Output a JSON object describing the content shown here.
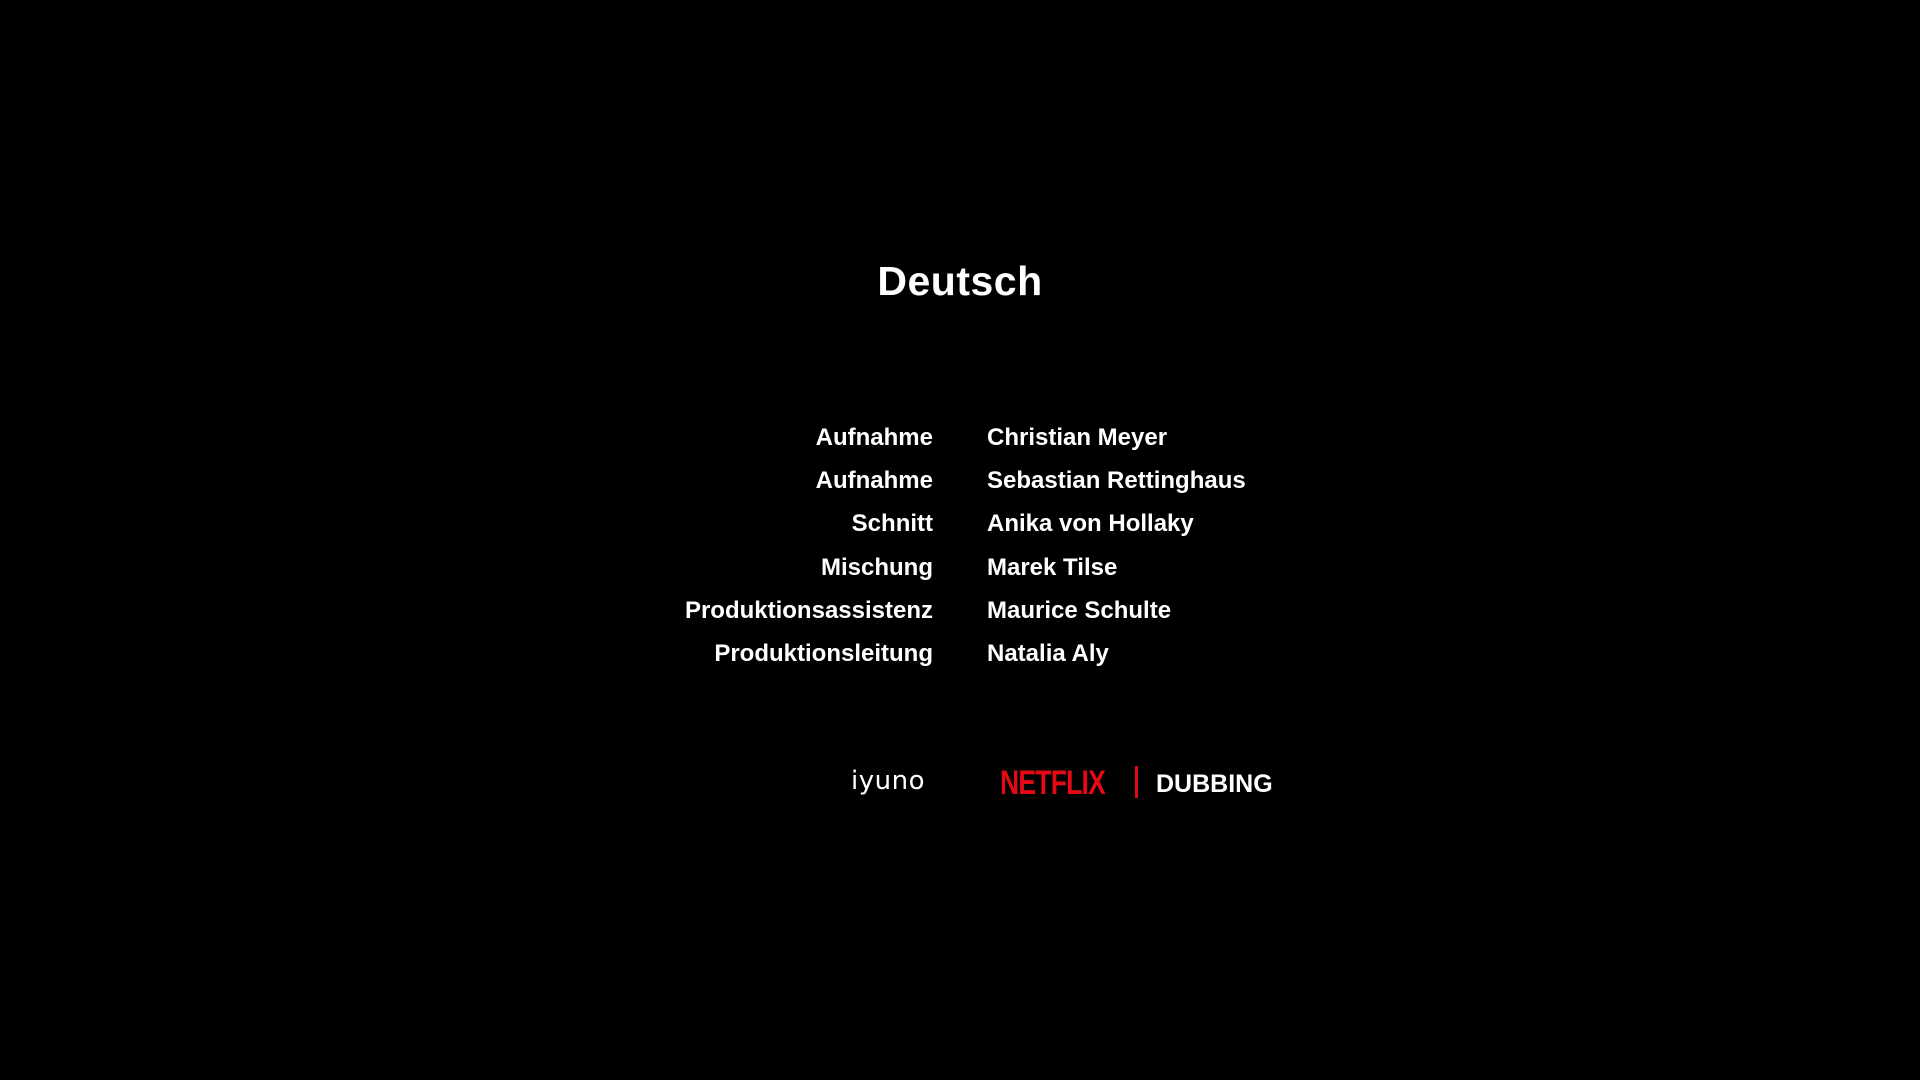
{
  "section": {
    "title": "Deutsch"
  },
  "credits": [
    {
      "role": "Aufnahme",
      "name": "Christian Meyer"
    },
    {
      "role": "Aufnahme",
      "name": "Sebastian Rettinghaus"
    },
    {
      "role": "Schnitt",
      "name": "Anika von Hollaky"
    },
    {
      "role": "Mischung",
      "name": "Marek Tilse"
    },
    {
      "role": "Produktionsassistenz",
      "name": "Maurice Schulte"
    },
    {
      "role": "Produktionsleitung",
      "name": "Natalia Aly"
    }
  ],
  "logos": {
    "studio": "iyuno",
    "brand": "NETFLIX",
    "brand_suffix": "DUBBING",
    "brand_color": "#e50914"
  },
  "colors": {
    "background": "#000000",
    "text": "#ffffff"
  }
}
